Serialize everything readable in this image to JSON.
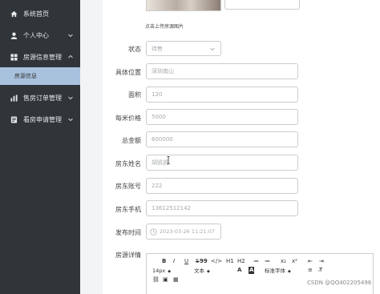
{
  "sidebar": {
    "items": [
      {
        "label": "系统首页",
        "icon": "home-icon",
        "has_submenu": false
      },
      {
        "label": "个人中心",
        "icon": "user-icon",
        "has_submenu": true
      },
      {
        "label": "房源信息管理",
        "icon": "grid-icon",
        "has_submenu": true,
        "expanded": true
      },
      {
        "label": "售房订单管理",
        "icon": "bar-chart-icon",
        "has_submenu": true
      },
      {
        "label": "看房申请管理",
        "icon": "doc-icon",
        "has_submenu": true
      }
    ],
    "submenu": {
      "label": "房源信息",
      "active": true
    }
  },
  "upload": {
    "tip": "点击上传房源图片"
  },
  "form": {
    "status": {
      "label": "状态",
      "value": "待售"
    },
    "location": {
      "label": "具体位置",
      "value": "深圳南山"
    },
    "area": {
      "label": "面积",
      "value": "120"
    },
    "unit_price": {
      "label": "每米价格",
      "value": "5000"
    },
    "total": {
      "label": "总金额",
      "value": "600000"
    },
    "owner_name": {
      "label": "房东姓名",
      "value": "胡凯凯"
    },
    "owner_account": {
      "label": "房东账号",
      "value": "222"
    },
    "owner_phone": {
      "label": "房东手机",
      "value": "13612512142"
    },
    "publish_time": {
      "label": "发布时间",
      "value": "2023-03-26 11:21:07"
    },
    "details": {
      "label": "房源详情"
    }
  },
  "editor": {
    "toolbar_row1": [
      "B",
      "I",
      "U",
      "S",
      "99",
      "</>",
      "H1",
      "H2",
      "≔",
      "≔",
      "x₂",
      "x²",
      "⇤",
      "⇥"
    ],
    "font_size": "14px",
    "text_type": "文本",
    "font_family": "标准字体"
  },
  "watermark": "CSDN @QQ402205496",
  "colors": {
    "sidebar_bg": "#30353a",
    "submenu_active": "#a8c2de",
    "input_border": "#c9ccd2"
  }
}
